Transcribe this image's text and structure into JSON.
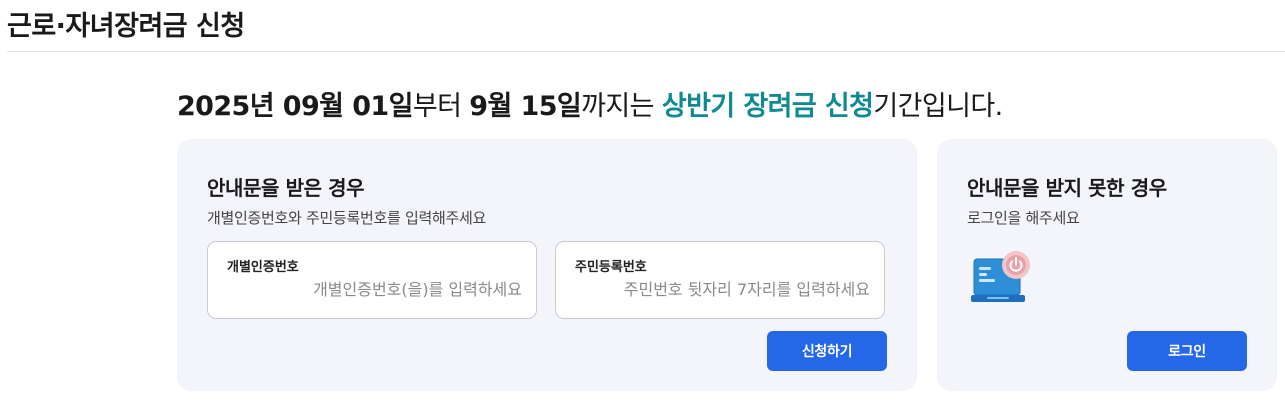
{
  "page": {
    "title": "근로·자녀장려금 신청"
  },
  "period": {
    "start": "2025년 09월 01일",
    "from_suffix": "부터 ",
    "end": "9월 15일",
    "until_suffix": "까지는 ",
    "highlight": "상반기 장려금 신청",
    "tail": "기간입니다."
  },
  "notice_received": {
    "title": "안내문을 받은 경우",
    "subtitle": "개별인증번호와 주민등록번호를 입력해주세요",
    "fields": [
      {
        "label": "개별인증번호",
        "placeholder": "개별인증번호(을)를 입력하세요",
        "value": ""
      },
      {
        "label": "주민등록번호",
        "placeholder": "주민번호 뒷자리 7자리를 입력하세요",
        "value": ""
      }
    ],
    "submit_label": "신청하기"
  },
  "notice_not_received": {
    "title": "안내문을 받지 못한 경우",
    "subtitle": "로그인을 해주세요",
    "icon": "computer-power-icon",
    "login_label": "로그인"
  },
  "colors": {
    "accent_teal": "#0f8a92",
    "button_blue": "#2468e8",
    "card_bg": "#f3f5fb",
    "icon_power": "#e8a3a8"
  }
}
